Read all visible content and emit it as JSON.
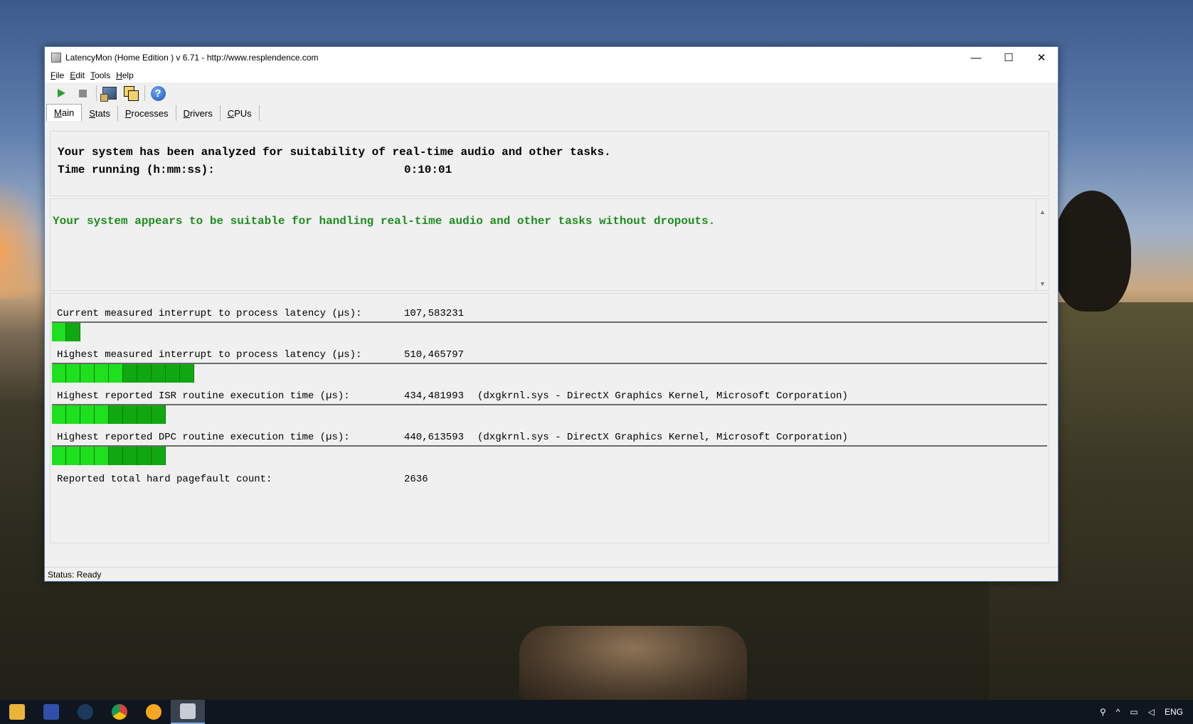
{
  "window": {
    "title": "LatencyMon  (Home Edition )  v 6.71 - http://www.resplendence.com",
    "minimize": "—",
    "maximize": "☐",
    "close": "✕"
  },
  "menu": [
    "File",
    "Edit",
    "Tools",
    "Help"
  ],
  "toolbar": {
    "start": "play-icon",
    "stop": "stop-icon",
    "monitor": "monitor-settings-icon",
    "windows": "windows-icon",
    "help": "?"
  },
  "tabs": [
    "Main",
    "Stats",
    "Processes",
    "Drivers",
    "CPUs"
  ],
  "active_tab": "Main",
  "summary": {
    "line1": "Your system has been analyzed for suitability of real-time audio and other tasks.",
    "time_label": "Time running (h:mm:ss):",
    "time_value": "0:10:01"
  },
  "conclusion": "Your system appears to be suitable for handling real-time audio and other tasks without dropouts.",
  "colors": {
    "conclusion": "#1e8c1e",
    "bar_light": "#1ee01e",
    "bar_dark": "#10a810"
  },
  "stats": [
    {
      "label": "Current measured interrupt to process latency (µs):",
      "value": "107,583231",
      "driver": "",
      "level_segments": 2
    },
    {
      "label": "Highest measured interrupt to process latency (µs):",
      "value": "510,465797",
      "driver": "",
      "level_segments": 10
    },
    {
      "label": "Highest reported ISR routine execution time (µs):",
      "value": "434,481993",
      "driver": "(dxgkrnl.sys - DirectX Graphics Kernel, Microsoft Corporation)",
      "level_segments": 8
    },
    {
      "label": "Highest reported DPC routine execution time (µs):",
      "value": "440,613593",
      "driver": "(dxgkrnl.sys - DirectX Graphics Kernel, Microsoft Corporation)",
      "level_segments": 8
    },
    {
      "label": "Reported total hard pagefault count:",
      "value": "2636",
      "driver": ""
    }
  ],
  "status": "Status: Ready",
  "taskbar": {
    "apps": [
      "file-explorer-icon",
      "save-icon",
      "steam-icon",
      "chrome-icon",
      "app-icon",
      "latencymon-icon"
    ],
    "lang": "ENG"
  }
}
